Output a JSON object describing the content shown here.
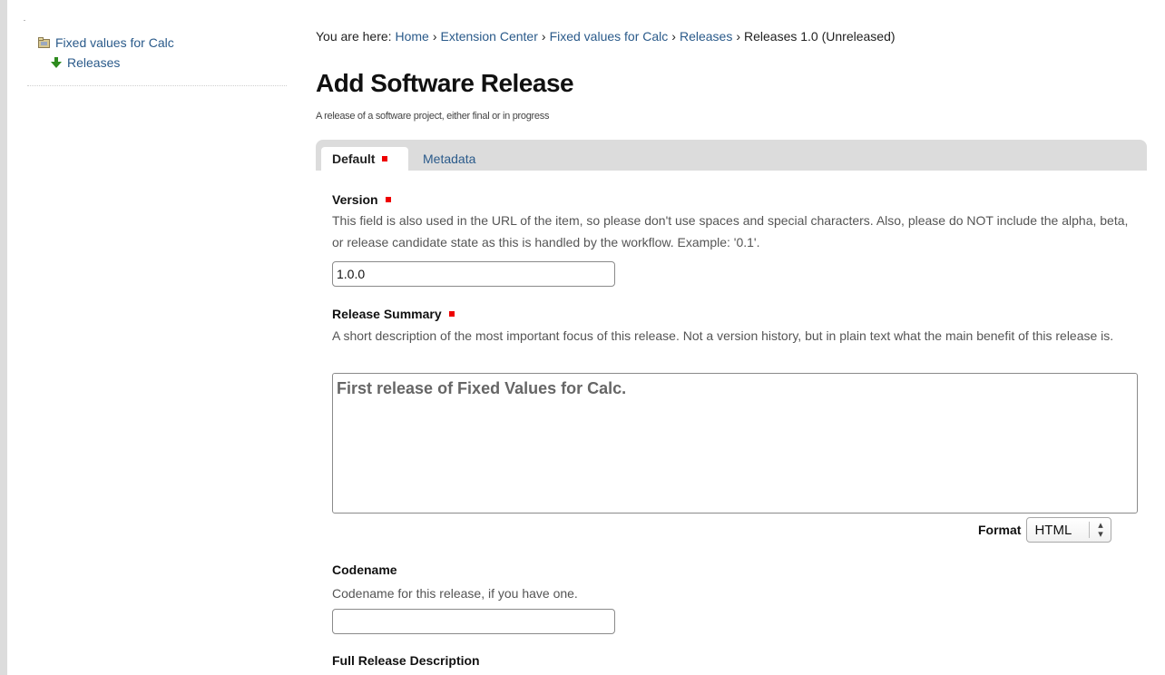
{
  "sidebar": {
    "items": [
      {
        "label": "Fixed values for Calc",
        "icon": "folder-icon"
      },
      {
        "label": "Releases",
        "icon": "arrow-down-icon"
      }
    ]
  },
  "breadcrumb": {
    "prefix": "You are here:",
    "items": [
      "Home",
      "Extension Center",
      "Fixed values for Calc",
      "Releases"
    ],
    "current": "Releases 1.0 (Unreleased)",
    "separator": "›"
  },
  "page": {
    "title": "Add Software Release",
    "description": "A release of a software project, either final or in progress"
  },
  "tabs": [
    {
      "label": "Default",
      "active": true
    },
    {
      "label": "Metadata",
      "active": false
    }
  ],
  "form": {
    "version": {
      "label": "Version",
      "help": "This field is also used in the URL of the item, so please don't use spaces and special characters. Also, please do NOT include the alpha, beta, or release candidate state as this is handled by the workflow. Example: '0.1'.",
      "value": "1.0.0"
    },
    "summary": {
      "label": "Release Summary",
      "help": "A short description of the most important focus of this release. Not a version history, but in plain text what the main benefit of this release is.",
      "value": "First release of Fixed Values for Calc."
    },
    "format": {
      "label": "Format",
      "value": "HTML"
    },
    "codename": {
      "label": "Codename",
      "help": "Codename for this release, if you have one.",
      "value": ""
    },
    "full_description": {
      "label": "Full Release Description"
    }
  },
  "colors": {
    "link": "#2a5a8a",
    "required": "#ee0000",
    "tabbar": "#dcdcdc"
  }
}
